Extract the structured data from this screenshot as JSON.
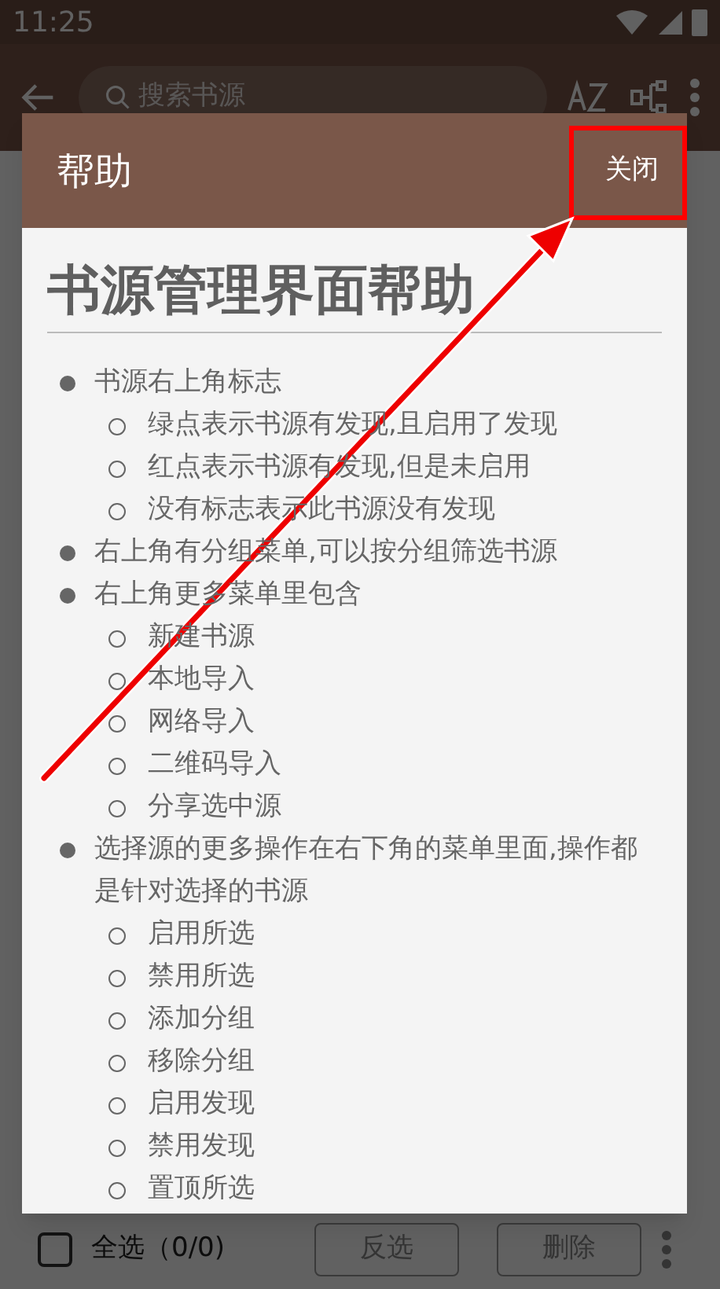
{
  "status_bar": {
    "time": "11:25"
  },
  "toolbar": {
    "search": {
      "placeholder": "搜索书源"
    }
  },
  "dialog": {
    "title": "帮助",
    "close_button": "关闭",
    "heading": "书源管理界面帮助",
    "items": [
      {
        "text": "书源右上角标志",
        "children": [
          {
            "text": "绿点表示书源有发现,且启用了发现"
          },
          {
            "text": "红点表示书源有发现,但是未启用"
          },
          {
            "text": "没有标志表示此书源没有发现"
          }
        ]
      },
      {
        "text": "右上角有分组菜单,可以按分组筛选书源"
      },
      {
        "text": "右上角更多菜单里包含",
        "children": [
          {
            "text": "新建书源"
          },
          {
            "text": "本地导入"
          },
          {
            "text": "网络导入"
          },
          {
            "text": "二维码导入"
          },
          {
            "text": "分享选中源"
          }
        ]
      },
      {
        "text": "选择源的更多操作在右下角的菜单里面,操作都是针对选择的书源",
        "children": [
          {
            "text": "启用所选"
          },
          {
            "text": "禁用所选"
          },
          {
            "text": "添加分组"
          },
          {
            "text": "移除分组"
          },
          {
            "text": "启用发现"
          },
          {
            "text": "禁用发现"
          },
          {
            "text": "置顶所选"
          }
        ]
      }
    ]
  },
  "bottom_bar": {
    "select_all": {
      "label": "全选（0/0)",
      "checked": false
    },
    "buttons": [
      "反选",
      "删除"
    ]
  }
}
